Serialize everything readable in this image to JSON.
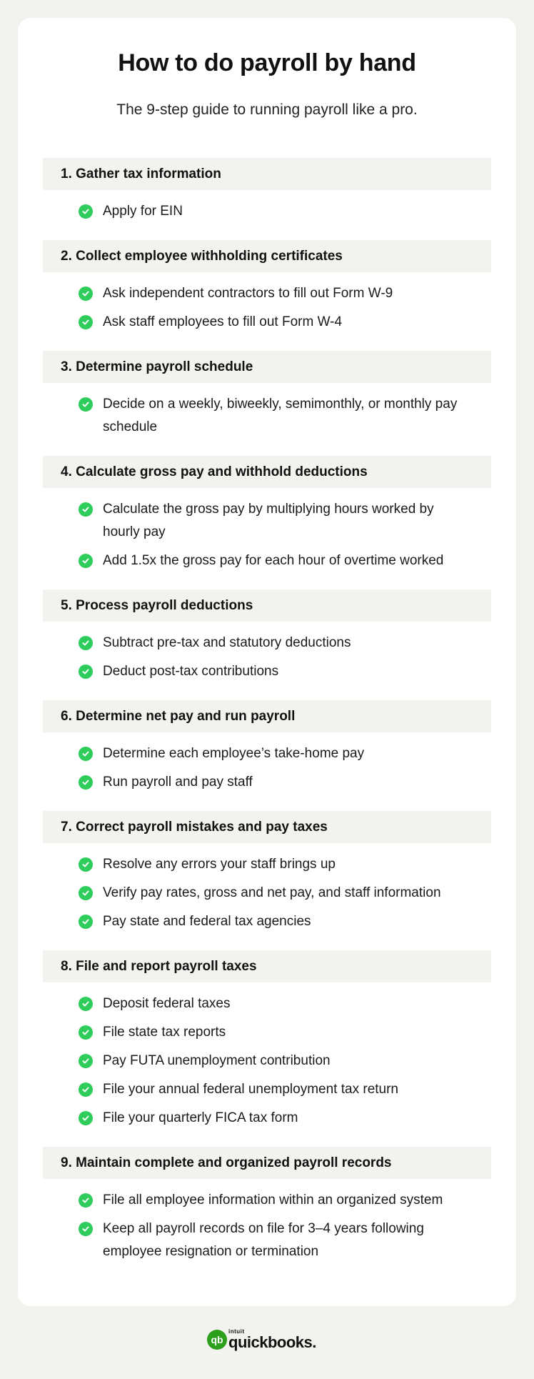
{
  "header": {
    "title": "How to do payroll by hand",
    "subtitle": "The 9-step guide to running payroll like a pro."
  },
  "colors": {
    "background": "#f2f2ee",
    "card": "#ffffff",
    "step_header_bg": "#f2f2ee",
    "check_green": "#2ecc5a",
    "brand_green": "#2ca01c"
  },
  "steps": [
    {
      "label": "1. Gather tax information",
      "items": [
        "Apply for EIN"
      ]
    },
    {
      "label": "2. Collect employee withholding certificates",
      "items": [
        "Ask independent contractors to fill out Form W-9",
        "Ask staff employees to fill out Form W-4"
      ]
    },
    {
      "label": "3. Determine payroll schedule",
      "items": [
        "Decide on a weekly, biweekly, semimonthly, or monthly pay schedule"
      ]
    },
    {
      "label": "4. Calculate gross pay and withhold deductions",
      "items": [
        "Calculate the gross pay by multiplying hours worked by hourly pay",
        "Add 1.5x the gross pay for each hour of overtime worked"
      ]
    },
    {
      "label": "5. Process payroll deductions",
      "items": [
        "Subtract pre-tax and statutory deductions",
        "Deduct post-tax contributions"
      ]
    },
    {
      "label": "6. Determine net pay and run payroll",
      "items": [
        "Determine each employee’s take-home pay",
        "Run payroll and pay staff"
      ]
    },
    {
      "label": "7. Correct payroll mistakes and pay taxes",
      "items": [
        "Resolve any errors your staff brings up",
        "Verify pay rates, gross and net pay, and staff information",
        "Pay state and federal tax agencies"
      ]
    },
    {
      "label": "8. File and report payroll taxes",
      "items": [
        "Deposit federal taxes",
        "File state tax reports",
        "Pay FUTA unemployment contribution",
        "File your annual federal unemployment tax return",
        "File your quarterly FICA tax form"
      ]
    },
    {
      "label": "9. Maintain complete and organized payroll records",
      "items": [
        "File all employee information within an organized system",
        "Keep all payroll records on file for 3–4 years following employee resignation or termination"
      ]
    }
  ],
  "footer": {
    "logo_badge": "qb",
    "logo_small": "intuit",
    "logo_name": "quickbooks."
  }
}
